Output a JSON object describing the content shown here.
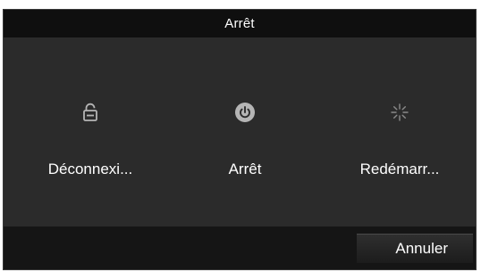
{
  "dialog": {
    "title": "Arrêt"
  },
  "options": [
    {
      "label": "Déconnexi...",
      "icon": "lock-icon"
    },
    {
      "label": "Arrêt",
      "icon": "power-icon"
    },
    {
      "label": "Redémarr...",
      "icon": "restart-icon"
    }
  ],
  "footer": {
    "cancel_label": "Annuler"
  },
  "colors": {
    "titlebar_bg": "#0f0f0f",
    "panel_bg": "#2b2b2b",
    "footer_bg": "#151515",
    "text": "#ffffff",
    "icon": "#b5b5b5"
  }
}
